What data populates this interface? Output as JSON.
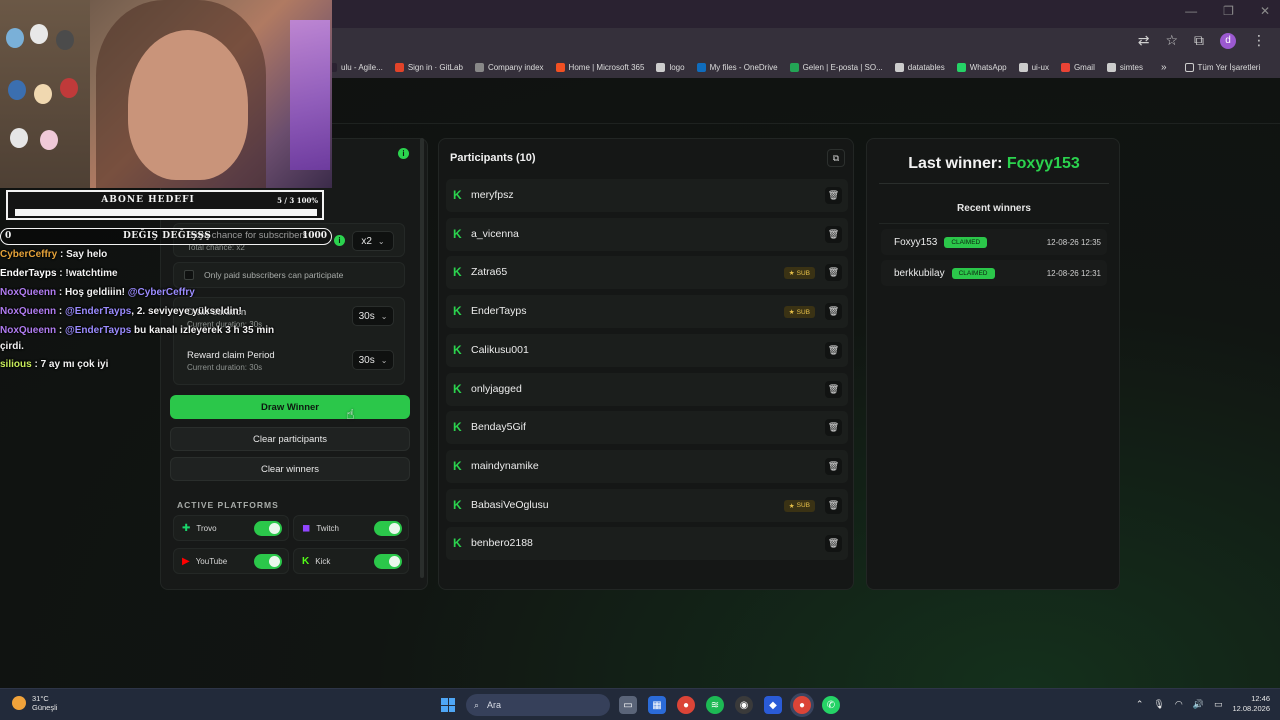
{
  "browser": {
    "bookmarks": [
      {
        "label": "ulu - Agile...",
        "color": "#2a2231"
      },
      {
        "label": "Sign in · GitLab",
        "color": "#e24329"
      },
      {
        "label": "Company index",
        "color": "#888888"
      },
      {
        "label": "Home | Microsoft 365",
        "color": "#f25022"
      },
      {
        "label": "logo",
        "color": "#cccccc"
      },
      {
        "label": "My files - OneDrive",
        "color": "#0f6cbd"
      },
      {
        "label": "Gelen | E-posta | SO...",
        "color": "#23a455"
      },
      {
        "label": "datatables",
        "color": "#cccccc"
      },
      {
        "label": "WhatsApp",
        "color": "#25d366"
      },
      {
        "label": "ui-ux",
        "color": "#cccccc"
      },
      {
        "label": "Gmail",
        "color": "#ea4335"
      },
      {
        "label": "simtes",
        "color": "#cccccc"
      }
    ],
    "more_label": "»",
    "all_bookmarks_label": "Tüm Yer İşaretleri",
    "profile_letter": "d"
  },
  "settings": {
    "multiplier_title": "Extra chance for subscribers",
    "multiplier_sub": "Total chance: x2",
    "multiplier_value": "x2",
    "paid_only_label": "Only paid subscribers can participate",
    "duration_title": "Draw duration",
    "duration_sub": "Current duration: 30s",
    "duration_value": "30s",
    "reward_title": "Reward claim Period",
    "reward_sub": "Current duration: 30s",
    "reward_value": "30s",
    "draw_label": "Draw Winner",
    "clear_participants_label": "Clear participants",
    "clear_winners_label": "Clear winners",
    "platforms_title": "ACTIVE PLATFORMS",
    "platforms": [
      {
        "name": "Trovo",
        "color": "#19d66b",
        "icon": "trovo-icon",
        "glyph": "✚",
        "on": true
      },
      {
        "name": "Twitch",
        "color": "#9146ff",
        "icon": "twitch-icon",
        "glyph": "◼",
        "on": true
      },
      {
        "name": "YouTube",
        "color": "#ff0000",
        "icon": "youtube-icon",
        "glyph": "▶",
        "on": true
      },
      {
        "name": "Kick",
        "color": "#53fc18",
        "icon": "kick-icon",
        "glyph": "K",
        "on": true
      }
    ]
  },
  "participants": {
    "title": "Participants (10)",
    "sub_badge": "SUB",
    "list": [
      {
        "name": "meryfpsz",
        "sub": false
      },
      {
        "name": "a_vicenna",
        "sub": false
      },
      {
        "name": "Zatra65",
        "sub": true
      },
      {
        "name": "EnderTayps",
        "sub": true
      },
      {
        "name": "Calikusu001",
        "sub": false
      },
      {
        "name": "onlyjagged",
        "sub": false
      },
      {
        "name": "Benday5Gif",
        "sub": false
      },
      {
        "name": "maindynamike",
        "sub": false
      },
      {
        "name": "BabasiVeOglusu",
        "sub": true
      },
      {
        "name": "benbero2188",
        "sub": false
      }
    ]
  },
  "winners": {
    "last_label": "Last winner:",
    "last_name": "Foxyy153",
    "recent_title": "Recent winners",
    "claimed_label": "CLAIMED",
    "list": [
      {
        "name": "Foxyy153",
        "date": "12-08-26 12:35"
      },
      {
        "name": "berkkubilay",
        "date": "12-08-26 12:31"
      }
    ]
  },
  "overlay": {
    "goal_title": "ABONE HEDEFI",
    "goal_progress": "5 / 3  100%",
    "goal_fraction": 1.0,
    "sub_left": "0",
    "sub_mid": "DEĞIŞ DEĞIŞŞŞ",
    "sub_right": "1000",
    "chat": [
      {
        "user": "CyberCeffry",
        "sep": " : ",
        "msg": "Say helo",
        "ucls": "u1"
      },
      {
        "user": "EnderTayps",
        "sep": " : ",
        "msg": "!watchtime",
        "ucls": "u2"
      },
      {
        "user": "NoxQueenn",
        "sep": " : ",
        "msg": "Hoş geldiiin! ",
        "mention": "@CyberCeffry",
        "ucls": "u3"
      },
      {
        "user": "NoxQueenn",
        "sep": " : ",
        "msg": "",
        "mention": "@EnderTayps",
        "msg2": ", 2. seviyeye yükseldin!",
        "ucls": "u3"
      },
      {
        "user": "NoxQueenn",
        "sep": " : ",
        "msg": "",
        "mention": "@EnderTayps",
        "msg2": " bu kanalı izleyerek 3 h 35 min",
        "ucls": "u3"
      },
      {
        "user": "",
        "sep": "",
        "msg": "çirdi.",
        "ucls": "u2"
      },
      {
        "user": "silious",
        "sep": " : ",
        "msg": "7 ay mı çok iyi",
        "ucls": "u4"
      }
    ]
  },
  "taskbar": {
    "temp": "31°C",
    "weather": "Güneşli",
    "search_placeholder": "Ara",
    "time": "12:46",
    "date": "12.08.2026"
  }
}
